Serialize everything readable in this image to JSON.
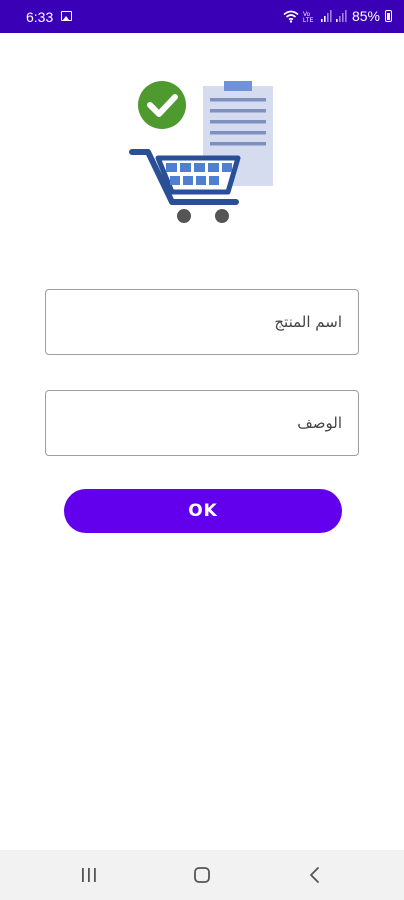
{
  "status_bar": {
    "time": "6:33",
    "battery_percent": "85%",
    "icons": [
      "gallery-icon",
      "wifi-icon",
      "volte-icon",
      "signal-icon",
      "signal-icon",
      "battery-icon"
    ]
  },
  "illustration": {
    "icons": [
      "check-circle-icon",
      "clipboard-icon",
      "shopping-cart-icon"
    ],
    "colors": {
      "check": "#4e9a2f",
      "clipboard": "#d6dcef",
      "clipboard_lines": "#7f8fbf",
      "cart": "#2a4f96",
      "cart_basket": "#4f7fd0",
      "wheels": "#555555"
    }
  },
  "form": {
    "product_name_placeholder": "اسم المنتج",
    "description_placeholder": "الوصف",
    "ok_label": "OK"
  },
  "colors": {
    "status_bar": "#3a00b5",
    "button": "#6200ee",
    "nav_bar": "#f2f2f2"
  },
  "nav_bar": {
    "buttons": [
      "recents-icon",
      "home-icon",
      "back-icon"
    ]
  }
}
